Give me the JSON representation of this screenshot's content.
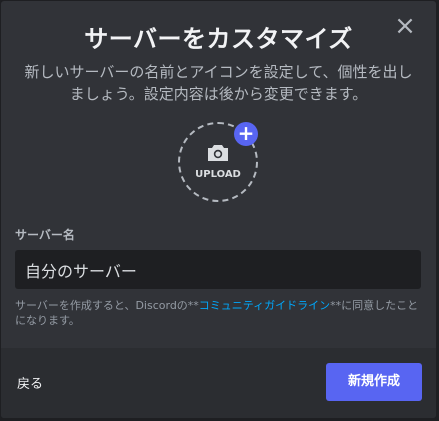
{
  "modal": {
    "title": "サーバーをカスタマイズ",
    "subtitle": "新しいサーバーの名前とアイコンを設定して、個性を出しましょう。設定内容は後から変更できます。",
    "close_icon": "close-icon"
  },
  "upload": {
    "label": "UPLOAD",
    "icon": "camera-icon",
    "add_icon": "+"
  },
  "server_name": {
    "label": "サーバー名",
    "value": "自分のサーバー"
  },
  "terms": {
    "prefix": "サーバーを作成すると、Discordの**",
    "link": "コミュニティガイドライン",
    "suffix": "**に同意したことになります。"
  },
  "footer": {
    "back_label": "戻る",
    "create_label": "新規作成"
  },
  "colors": {
    "background": "#313338",
    "footer": "#2b2d31",
    "accent": "#5865f2",
    "link": "#00a8fc"
  }
}
